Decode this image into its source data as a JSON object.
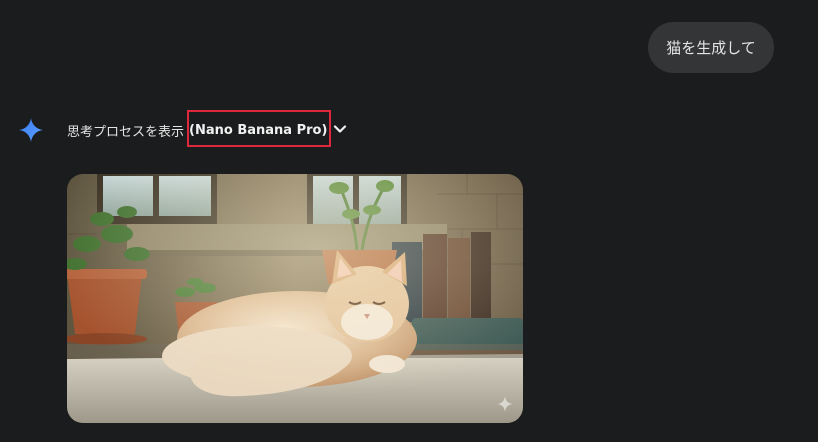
{
  "user_message": {
    "text": "猫を生成して"
  },
  "assistant": {
    "thinking_label": "思考プロセスを表示",
    "model_name": "(Nano Banana Pro)",
    "chevron_icon": "chevron-down-icon",
    "avatar_icon": "gemini-sparkle-icon"
  },
  "generated_image": {
    "alt": "猫を生成して",
    "watermark_icon": "sparkle-icon"
  },
  "colors": {
    "background": "#1b1c1d",
    "bubble": "#333537",
    "highlight": "#e0283c",
    "gemini_blue": "#4a8cf7"
  }
}
